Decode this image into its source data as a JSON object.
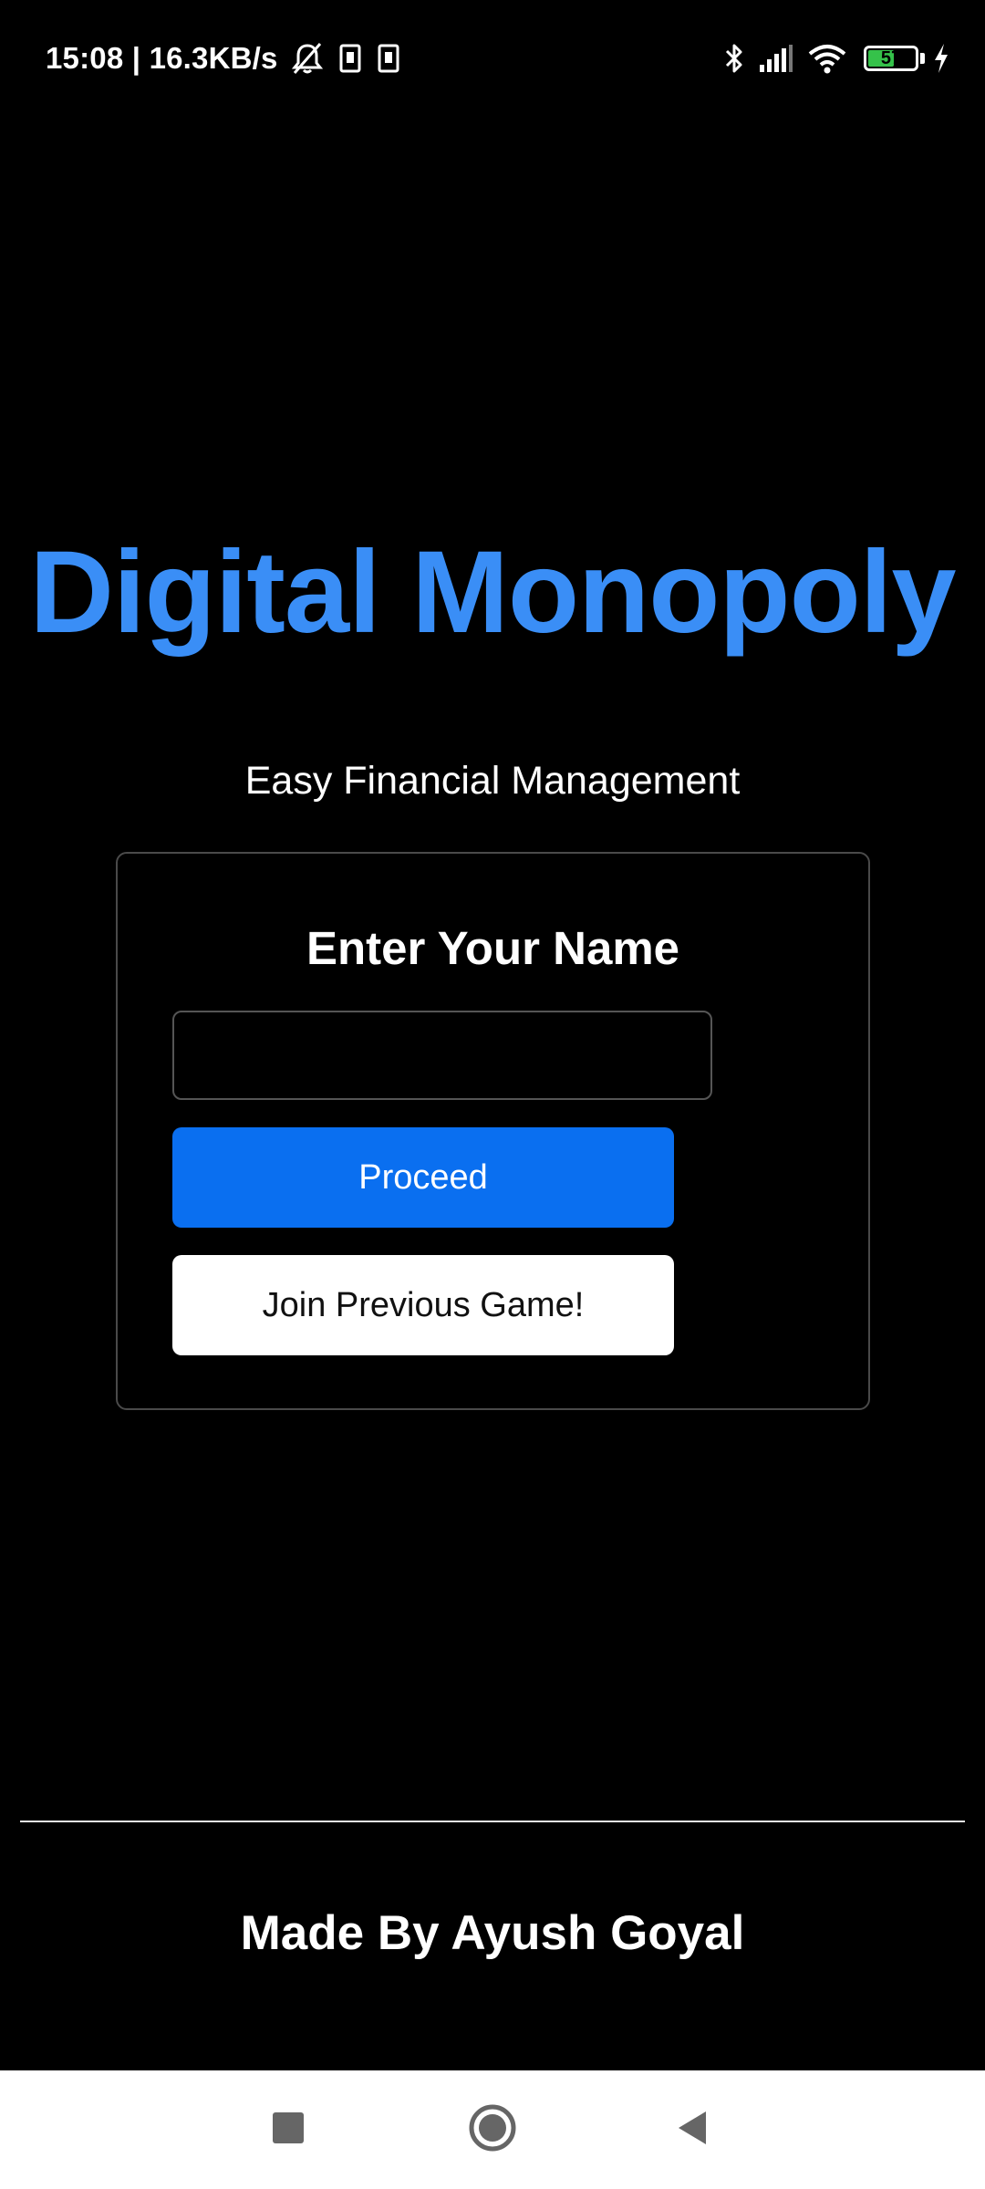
{
  "status_bar": {
    "time_speed": "15:08 | 16.3KB/s",
    "battery_level": "57",
    "battery_fraction": 0.57,
    "battery_color": "#35c24a",
    "icons": [
      "alarm-off-icon",
      "sim-card-icon",
      "sim-card-icon",
      "bluetooth-icon",
      "signal-icon",
      "wifi-icon",
      "battery-icon",
      "charging-icon"
    ]
  },
  "main": {
    "title": "Digital Monopoly",
    "subtitle": "Easy Financial Management",
    "title_color": "#3a8ef6"
  },
  "name_card": {
    "heading": "Enter Your Name",
    "input_value": "",
    "input_placeholder": "",
    "proceed_label": "Proceed",
    "join_label": "Join Previous Game!",
    "proceed_color": "#0a6ff0"
  },
  "footer": {
    "credit": "Made By Ayush Goyal"
  },
  "nav_bar": {
    "buttons": [
      "recents-icon",
      "home-icon",
      "back-icon"
    ]
  }
}
